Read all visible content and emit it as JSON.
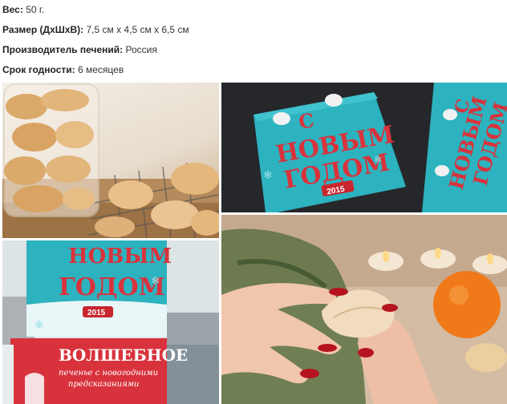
{
  "specs": [
    {
      "label": "Вес:",
      "value": "50 г."
    },
    {
      "label": "Размер (ДхШхВ):",
      "value": "7,5 см х 4,5 см х 6,5 см"
    },
    {
      "label": "Производитель печений:",
      "value": "Россия"
    },
    {
      "label": "Срок годности:",
      "value": "6 месяцев"
    }
  ],
  "box": {
    "greeting_line1": "С",
    "greeting_line2": "НОВЫМ",
    "greeting_line3": "ГОДОМ",
    "year": "2015",
    "lower_box_title": "ВОЛШЕБНОЕ",
    "lower_box_subtitle_1": "печенье с новогодними",
    "lower_box_subtitle_2": "предсказаниями"
  },
  "colors": {
    "box_teal": "#2cb3bf",
    "box_red": "#d8333c",
    "cookie": "#e7c48f"
  },
  "icons": [
    "sheep-icon",
    "snowflake-icon",
    "candle-icon",
    "tangerine-icon"
  ]
}
